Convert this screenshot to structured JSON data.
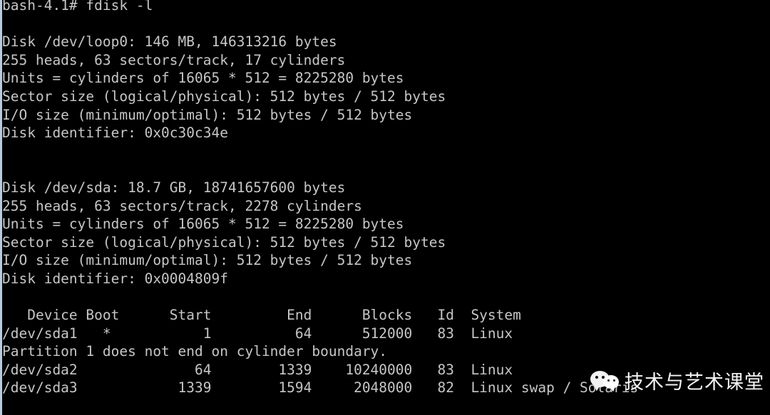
{
  "terminal": {
    "shell_prompt": "bash-4.1#",
    "command": "fdisk -l",
    "foreground_color": "#c6c6c6",
    "background_color": "#000000",
    "edge_strip_color": "#b9cbdd",
    "lines": [
      "bash-4.1# fdisk -l",
      "",
      "Disk /dev/loop0: 146 MB, 146313216 bytes",
      "255 heads, 63 sectors/track, 17 cylinders",
      "Units = cylinders of 16065 * 512 = 8225280 bytes",
      "Sector size (logical/physical): 512 bytes / 512 bytes",
      "I/O size (minimum/optimal): 512 bytes / 512 bytes",
      "Disk identifier: 0x0c30c34e",
      "",
      "",
      "Disk /dev/sda: 18.7 GB, 18741657600 bytes",
      "255 heads, 63 sectors/track, 2278 cylinders",
      "Units = cylinders of 16065 * 512 = 8225280 bytes",
      "Sector size (logical/physical): 512 bytes / 512 bytes",
      "I/O size (minimum/optimal): 512 bytes / 512 bytes",
      "Disk identifier: 0x0004809f",
      "",
      "   Device Boot      Start         End      Blocks   Id  System",
      "/dev/sda1   *           1          64      512000   83  Linux",
      "Partition 1 does not end on cylinder boundary.",
      "/dev/sda2              64        1339    10240000   83  Linux",
      "/dev/sda3            1339        1594     2048000   82  Linux swap / Solaris"
    ]
  },
  "disks": [
    {
      "device": "/dev/loop0",
      "size_human": "146 MB",
      "size_bytes": "146313216",
      "heads": "255",
      "sectors_per_track": "63",
      "cylinders": "17",
      "units": "cylinders of 16065 * 512 = 8225280 bytes",
      "sector_size_logical": "512 bytes",
      "sector_size_physical": "512 bytes",
      "io_size_minimum": "512 bytes",
      "io_size_optimal": "512 bytes",
      "disk_identifier": "0x0c30c34e"
    },
    {
      "device": "/dev/sda",
      "size_human": "18.7 GB",
      "size_bytes": "18741657600",
      "heads": "255",
      "sectors_per_track": "63",
      "cylinders": "2278",
      "units": "cylinders of 16065 * 512 = 8225280 bytes",
      "sector_size_logical": "512 bytes",
      "sector_size_physical": "512 bytes",
      "io_size_minimum": "512 bytes",
      "io_size_optimal": "512 bytes",
      "disk_identifier": "0x0004809f"
    }
  ],
  "partition_table": {
    "headers": [
      "Device",
      "Boot",
      "Start",
      "End",
      "Blocks",
      "Id",
      "System"
    ],
    "rows": [
      {
        "device": "/dev/sda1",
        "boot": "*",
        "start": "1",
        "end": "64",
        "blocks": "512000",
        "id": "83",
        "system": "Linux"
      },
      {
        "device": "/dev/sda2",
        "boot": "",
        "start": "64",
        "end": "1339",
        "blocks": "10240000",
        "id": "83",
        "system": "Linux"
      },
      {
        "device": "/dev/sda3",
        "boot": "",
        "start": "1339",
        "end": "1594",
        "blocks": "2048000",
        "id": "82",
        "system": "Linux swap / Solaris"
      }
    ],
    "warnings": [
      "Partition 1 does not end on cylinder boundary."
    ]
  },
  "watermark": {
    "icon": "wechat-logo-icon",
    "text": "技术与艺术课堂",
    "text_color": "#f5f5f5"
  }
}
